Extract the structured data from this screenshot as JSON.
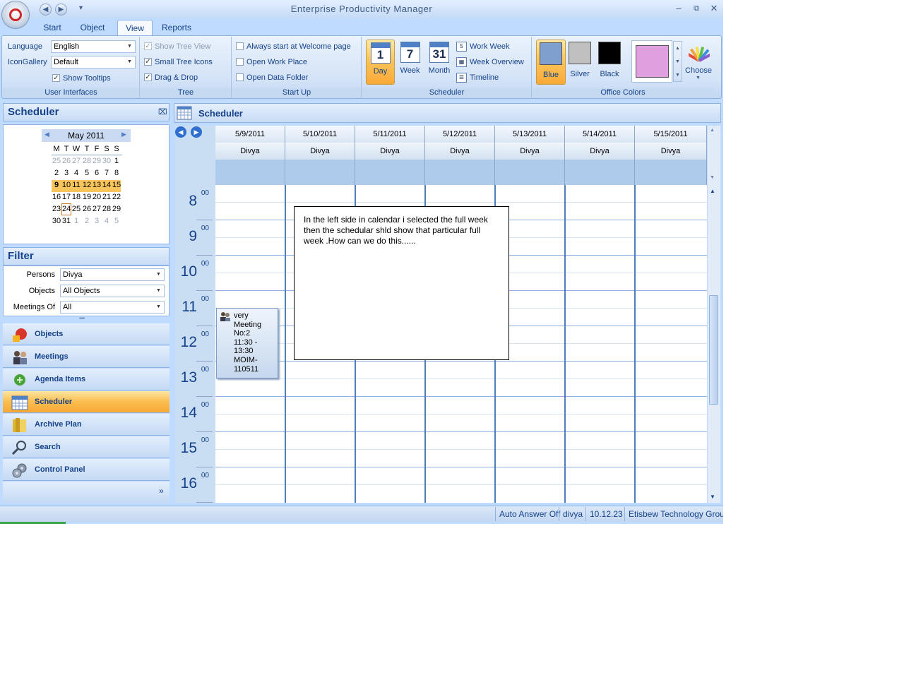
{
  "window": {
    "title": "Enterprise Productivity Manager",
    "controls": [
      "minimize-icon",
      "restore-icon",
      "close-icon"
    ]
  },
  "quick_access": [
    "back-icon",
    "forward-icon",
    "customize-icon"
  ],
  "tabs": [
    {
      "label": "Start",
      "active": false
    },
    {
      "label": "Object",
      "active": false
    },
    {
      "label": "View",
      "active": true
    },
    {
      "label": "Reports",
      "active": false
    }
  ],
  "ribbon": {
    "user_interfaces": {
      "label": "User Interfaces",
      "language_label": "Language",
      "language_value": "English",
      "icon_gallery_label": "IconGallery",
      "icon_gallery_value": "Default",
      "show_tooltips_label": "Show Tooltips",
      "show_tooltips_checked": true
    },
    "tree": {
      "label": "Tree",
      "show_tree_view_label": "Show Tree View",
      "show_tree_view_checked": true,
      "show_tree_view_disabled": true,
      "small_tree_icons_label": "Small Tree Icons",
      "small_tree_icons_checked": true,
      "drag_drop_label": "Drag & Drop",
      "drag_drop_checked": true
    },
    "start_up": {
      "label": "Start Up",
      "always_start_label": "Always start at Welcome page",
      "open_work_place_label": "Open Work Place",
      "open_data_folder_label": "Open Data Folder"
    },
    "scheduler": {
      "label": "Scheduler",
      "day_label": "Day",
      "day_num": "1",
      "week_label": "Week",
      "week_num": "7",
      "month_label": "Month",
      "month_num": "31",
      "work_week_label": "Work Week",
      "work_week_num": "5",
      "week_overview_label": "Week Overview",
      "timeline_label": "Timeline"
    },
    "office_colors": {
      "label": "Office Colors",
      "blue_label": "Blue",
      "blue_color": "#7f9fcf",
      "silver_label": "Silver",
      "silver_color": "#c0c0c0",
      "black_label": "Black",
      "black_color": "#000000",
      "custom_color": "#e0a0e0",
      "choose_label": "Choose"
    }
  },
  "left_panel": {
    "scheduler_title": "Scheduler",
    "mini_calendar": {
      "month_label": "May 2011",
      "weekdays": [
        "M",
        "T",
        "W",
        "T",
        "F",
        "S",
        "S"
      ],
      "weeks": [
        [
          "25",
          "26",
          "27",
          "28",
          "29",
          "30",
          "1"
        ],
        [
          "2",
          "3",
          "4",
          "5",
          "6",
          "7",
          "8"
        ],
        [
          "9",
          "10",
          "11",
          "12",
          "13",
          "14",
          "15"
        ],
        [
          "16",
          "17",
          "18",
          "19",
          "20",
          "21",
          "22"
        ],
        [
          "23",
          "24",
          "25",
          "26",
          "27",
          "28",
          "29"
        ],
        [
          "30",
          "31",
          "1",
          "2",
          "3",
          "4",
          "5"
        ]
      ]
    },
    "filter": {
      "title": "Filter",
      "persons_label": "Persons",
      "persons_value": "Divya",
      "objects_label": "Objects",
      "objects_value": "All Objects",
      "meetings_of_label": "Meetings Of",
      "meetings_of_value": "All"
    },
    "nav_items": [
      {
        "label": "Objects",
        "icon": "objects-icon",
        "active": false
      },
      {
        "label": "Meetings",
        "icon": "meetings-icon",
        "active": false
      },
      {
        "label": "Agenda Items",
        "icon": "agenda-items-icon",
        "active": false
      },
      {
        "label": "Scheduler",
        "icon": "scheduler-icon",
        "active": true
      },
      {
        "label": "Archive Plan",
        "icon": "archive-plan-icon",
        "active": false
      },
      {
        "label": "Search",
        "icon": "search-icon",
        "active": false
      },
      {
        "label": "Control Panel",
        "icon": "control-panel-icon",
        "active": false
      }
    ]
  },
  "scheduler": {
    "title": "Scheduler",
    "days": [
      {
        "date": "5/9/2011",
        "person": "Divya"
      },
      {
        "date": "5/10/2011",
        "person": "Divya"
      },
      {
        "date": "5/11/2011",
        "person": "Divya"
      },
      {
        "date": "5/12/2011",
        "person": "Divya"
      },
      {
        "date": "5/13/2011",
        "person": "Divya"
      },
      {
        "date": "5/14/2011",
        "person": "Divya"
      },
      {
        "date": "5/15/2011",
        "person": "Divya"
      }
    ],
    "hours": [
      "8",
      "9",
      "10",
      "11",
      "12",
      "13",
      "14",
      "15",
      "16"
    ],
    "minutes": "00",
    "appointment": {
      "line1": "very",
      "line2": "Meeting",
      "line3": "No:2",
      "line4": "11:30 -",
      "line5": "13:30",
      "line6": "MOIM-",
      "line7": "110511"
    },
    "note": "In the left side in calendar i selected the full week then the schedular shld show that particular full week .How can we do this......"
  },
  "status_bar": {
    "auto_answer": "Auto Answer Off",
    "user": "divya",
    "version": "10.12.23",
    "company": "Etisbew Technology Group"
  }
}
